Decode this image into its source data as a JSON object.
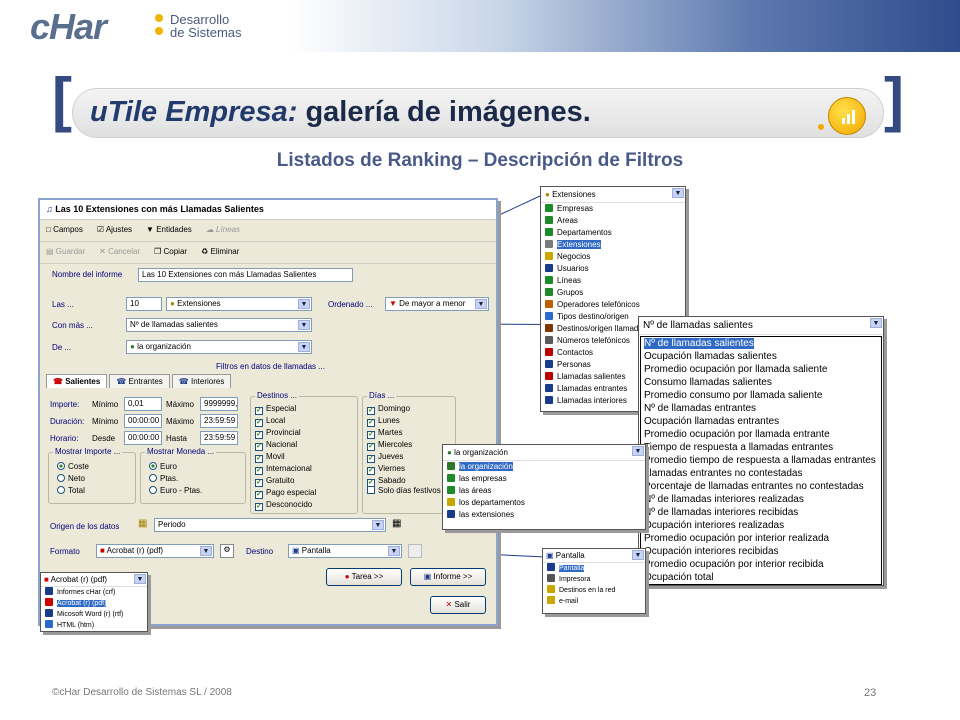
{
  "header": {
    "logo": "cHar",
    "logo_line1": "Desarrollo",
    "logo_line2": "de Sistemas"
  },
  "slide": {
    "title_italic": "uTile Empresa:",
    "title_rest": "galería de imágenes.",
    "subtitle": "Listados de Ranking – Descripción de Filtros",
    "footer": "©cHar Desarrollo de Sistemas SL / 2008",
    "page": "23"
  },
  "dialog": {
    "title": "Las 10 Extensiones con más Llamadas Salientes",
    "toolbar1": [
      "Campos",
      "Ajustes",
      "Entidades",
      "Líneas"
    ],
    "toolbar2": [
      "Guardar",
      "Cancelar",
      "Copiar",
      "Eliminar"
    ],
    "name_label": "Nombre del informe",
    "name_value": "Las 10 Extensiones con más Llamadas Salientes",
    "las_label": "Las ...",
    "las_value": "10",
    "las_select": "Extensiones",
    "ordenado_label": "Ordenado ...",
    "ordenado_value": "De mayor a menor",
    "conmas_label": "Con más ...",
    "conmas_value": "Nº de llamadas salientes",
    "de_label": "De ...",
    "de_value": "la organización",
    "filtros_label": "Filtros en datos de llamadas ...",
    "tabs": [
      "Salientes",
      "Entrantes",
      "Interiores"
    ],
    "importe_label": "Importe:",
    "duracion_label": "Duración:",
    "horario_label": "Horario:",
    "minimo": "Mínimo",
    "maximo": "Máximo",
    "desde": "Desde",
    "hasta": "Hasta",
    "importe_min": "0,01",
    "importe_max": "9999999,",
    "dur_min": "00:00:00",
    "dur_max": "23:59:59",
    "hor_desde": "00:00:00",
    "hor_hasta": "23:59:59",
    "destinos_label": "Destinos ...",
    "destinos": [
      "Especial",
      "Local",
      "Provincial",
      "Nacional",
      "Movil",
      "Internacional",
      "Gratuito",
      "Pago especial",
      "Desconocido"
    ],
    "dias_label": "Días ...",
    "dias": [
      "Domingo",
      "Lunes",
      "Martes",
      "Miercoles",
      "Jueves",
      "Viernes",
      "Sabado"
    ],
    "festivos": "Solo días festivos",
    "mostrar_importe_label": "Mostrar Importe ...",
    "mostrar_importe": [
      "Coste",
      "Neto",
      "Total"
    ],
    "mostrar_moneda_label": "Mostrar Moneda ...",
    "mostrar_moneda": [
      "Euro",
      "Ptas.",
      "Euro - Ptas."
    ],
    "origen_label": "Origen de los datos",
    "origen_value": "Periodo",
    "formato_label": "Formato",
    "formato_value": "Acrobat (r) (pdf)",
    "destino_label": "Destino",
    "destino_value": "Pantalla",
    "tarea_btn": "Tarea >>",
    "informe_btn": "Informe >>",
    "salir_btn": "Salir"
  },
  "format_popup": {
    "header": "Acrobat (r) (pdf)",
    "items": [
      "Informes cHar (crf)",
      "Acrobat (r) (pdf)",
      "Micosoft Word (r) (rtf)",
      "HTML (htm)"
    ],
    "selected": 1
  },
  "entity_popup": {
    "header": "Extensiones",
    "items": [
      "Empresas",
      "Areas",
      "Departamentos",
      "Extensiones",
      "Negocios",
      "Usuarios",
      "Líneas",
      "Grupos",
      "Operadores telefónicos",
      "Tipos destino/origen",
      "Destinos/origen llamad",
      "Números telefónicos",
      "Contactos",
      "Personas",
      "Llamadas salientes",
      "Llamadas entrantes",
      "Llamadas interiores"
    ],
    "selected": 3
  },
  "metric_popup": {
    "header": "Nº de llamadas salientes",
    "items": [
      "Nº de llamadas salientes",
      "Ocupación llamadas salientes",
      "Promedio ocupación por llamada saliente",
      "Consumo llamadas salientes",
      "Promedio consumo por llamada saliente",
      "Nº de llamadas entrantes",
      "Ocupación llamadas entrantes",
      "Promedio ocupación por llamada entrante",
      "Tiempo de respuesta a llamadas entrantes",
      "Promedio tiempo de respuesta a llamadas entrantes",
      "Llamadas entrantes no contestadas",
      "Porcentaje de llamadas entrantes no contestadas",
      "Nº de llamadas interiores realizadas",
      "Nº de llamadas interiores recibidas",
      "Ocupación interiores realizadas",
      "Promedio ocupación por interior realizada",
      "Ocupación interiores recibidas",
      "Promedio ocupación por interior recibida",
      "Ocupación total"
    ],
    "selected": 0
  },
  "org_popup": {
    "header": "la organización",
    "items": [
      "la organización",
      "las empresas",
      "las áreas",
      "los departamentos",
      "las extensiones"
    ],
    "selected": 0
  },
  "dest_popup": {
    "header": "Pantalla",
    "items": [
      "Pantalla",
      "Impresora",
      "Destinos en la red",
      "e-mail"
    ],
    "selected": 0
  }
}
